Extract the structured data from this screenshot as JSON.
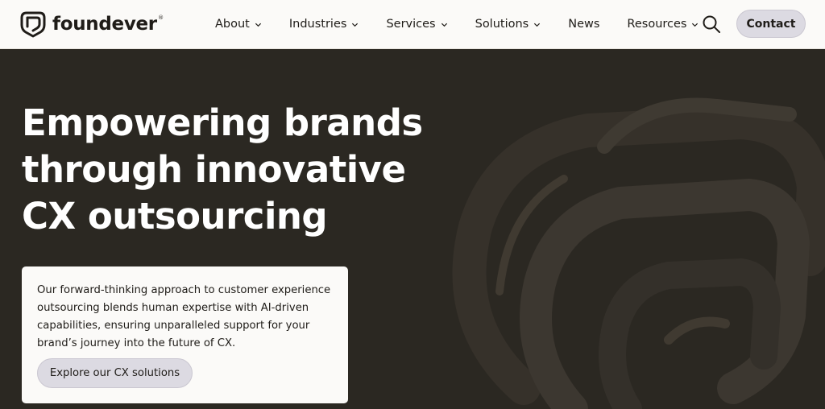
{
  "brand": {
    "name": "foundever",
    "registered_mark": "®"
  },
  "nav": {
    "items": [
      {
        "label": "About",
        "has_dropdown": true
      },
      {
        "label": "Industries",
        "has_dropdown": true
      },
      {
        "label": "Services",
        "has_dropdown": true
      },
      {
        "label": "Solutions",
        "has_dropdown": true
      },
      {
        "label": "News",
        "has_dropdown": false
      },
      {
        "label": "Resources",
        "has_dropdown": true
      }
    ],
    "search_icon": "search-icon",
    "contact_label": "Contact"
  },
  "hero": {
    "title_lines": [
      "Empowering brands",
      "through innovative",
      "CX outsourcing"
    ],
    "description_lines": [
      "Our forward-thinking approach to customer experience",
      "outsourcing blends human expertise with AI-driven",
      "capabilities, ensuring unparalleled support for your",
      "brand’s journey into the future of CX."
    ],
    "cta_label": "Explore our CX solutions"
  },
  "colors": {
    "header_bg": "#fbfaf8",
    "hero_bg": "#2b2822",
    "button_bg": "#dcdae2",
    "text_dark": "#1f1c18"
  }
}
